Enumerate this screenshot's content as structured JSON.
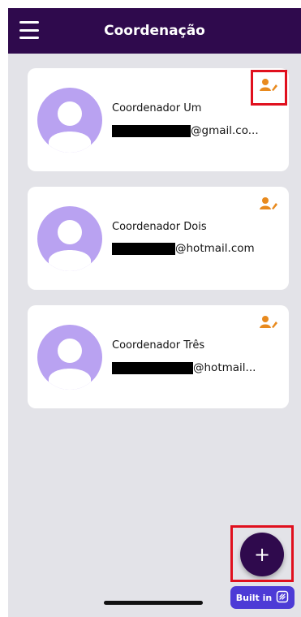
{
  "appbar": {
    "title": "Coordenação",
    "menu_icon": "hamburger-menu-icon",
    "background": "#2F0A4D"
  },
  "coordinators": [
    {
      "name": "Coordenador Um",
      "email_visible": "@gmail.co...",
      "edit_icon": "user-edit-icon"
    },
    {
      "name": "Coordenador Dois",
      "email_visible": "@hotmail.com",
      "edit_icon": "user-edit-icon"
    },
    {
      "name": "Coordenador Três",
      "email_visible": "@hotmail...",
      "edit_icon": "user-edit-icon"
    }
  ],
  "fab": {
    "label": "+",
    "icon": "plus-icon"
  },
  "badge": {
    "label": "Built in",
    "icon": "flutterflow-logo-icon"
  },
  "colors": {
    "accent_orange": "#E88A1E",
    "avatar_bg": "#B9A2F1",
    "highlight_red": "#E0101E",
    "badge_bg": "#4D3BD6"
  }
}
